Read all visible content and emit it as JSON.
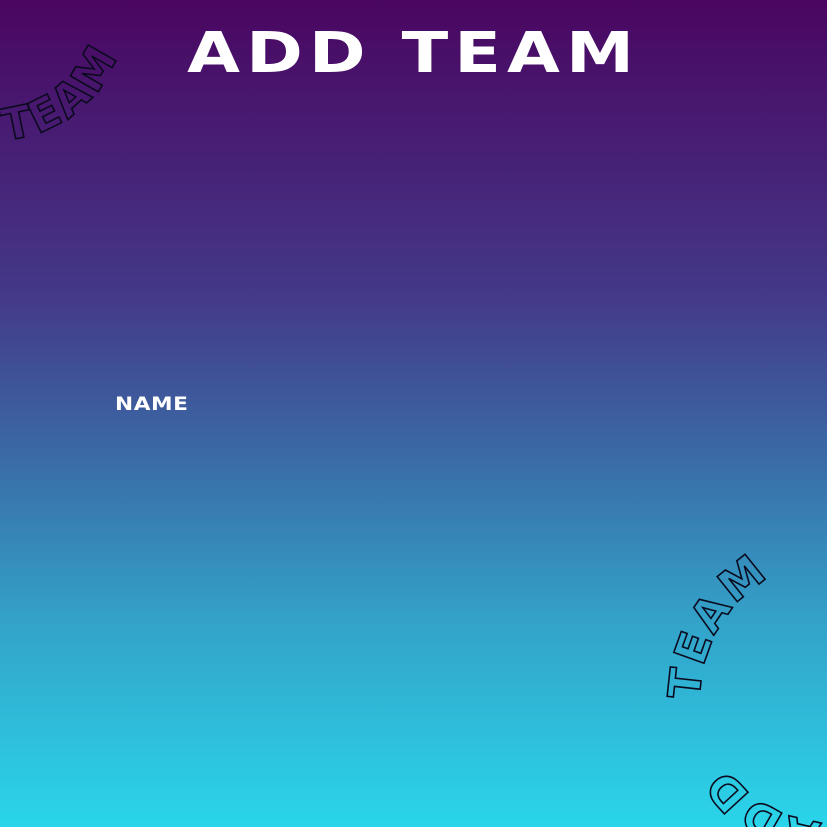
{
  "header": {
    "title": "ADD TEAM"
  },
  "form": {
    "name_label": "NAME"
  },
  "decorations": {
    "top_left_text": "TEAM",
    "bottom_right_text_1": "TEAM",
    "bottom_right_text_2": "ADD"
  },
  "colors": {
    "gradient_top": "#4a0661",
    "gradient_bottom": "#2ad5ea",
    "text": "#ffffff",
    "outline": "#0a0a1e"
  }
}
